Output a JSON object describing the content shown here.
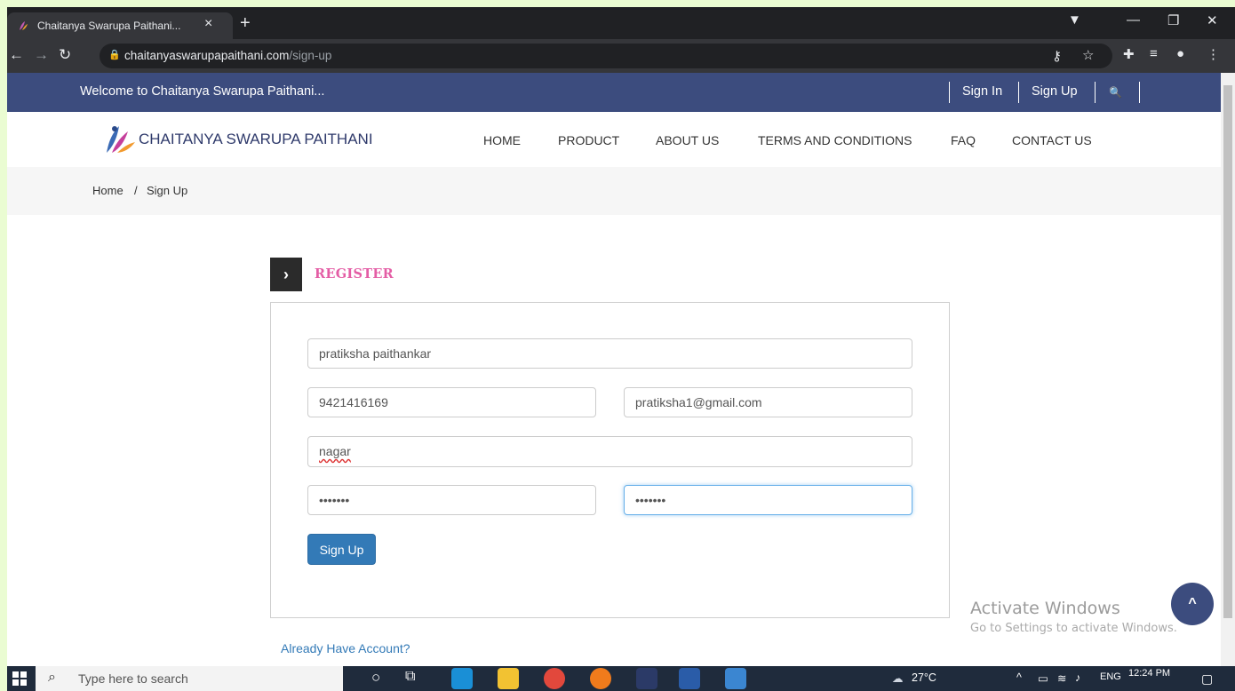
{
  "browser": {
    "tab_title": "Chaitanya Swarupa Paithani...",
    "tab_close": "×",
    "new_tab": "+",
    "url_domain": "chaitanyaswarupapaithani.com",
    "url_path": "/sign-up"
  },
  "site": {
    "welcome": "Welcome to Chaitanya Swarupa Paithani...",
    "sign_in": "Sign In",
    "sign_up": "Sign Up",
    "brand": "CHAITANYA SWARUPA PAITHANI",
    "nav": [
      "HOME",
      "PRODUCT",
      "ABOUT US",
      "TERMS AND CONDITIONS",
      "FAQ",
      "CONTACT US"
    ],
    "breadcrumb": {
      "home": "Home",
      "separator": "/",
      "current": "Sign Up"
    },
    "accent_color": "#3c4c7e"
  },
  "form": {
    "heading": "REGISTER",
    "name": "pratiksha paithankar",
    "mobile": "9421416169",
    "email": "pratiksha1@gmail.com",
    "address": "nagar",
    "password": "•••••••",
    "confirm_password": "•••••••",
    "submit_label": "Sign Up",
    "already_link": "Already Have Account?"
  },
  "overlay": {
    "activate_title": "Activate Windows",
    "activate_sub": "Go to Settings to activate Windows."
  },
  "taskbar": {
    "search_placeholder": "Type here to search",
    "temperature": "27°C",
    "lang": "ENG",
    "time": "12:24 PM"
  }
}
